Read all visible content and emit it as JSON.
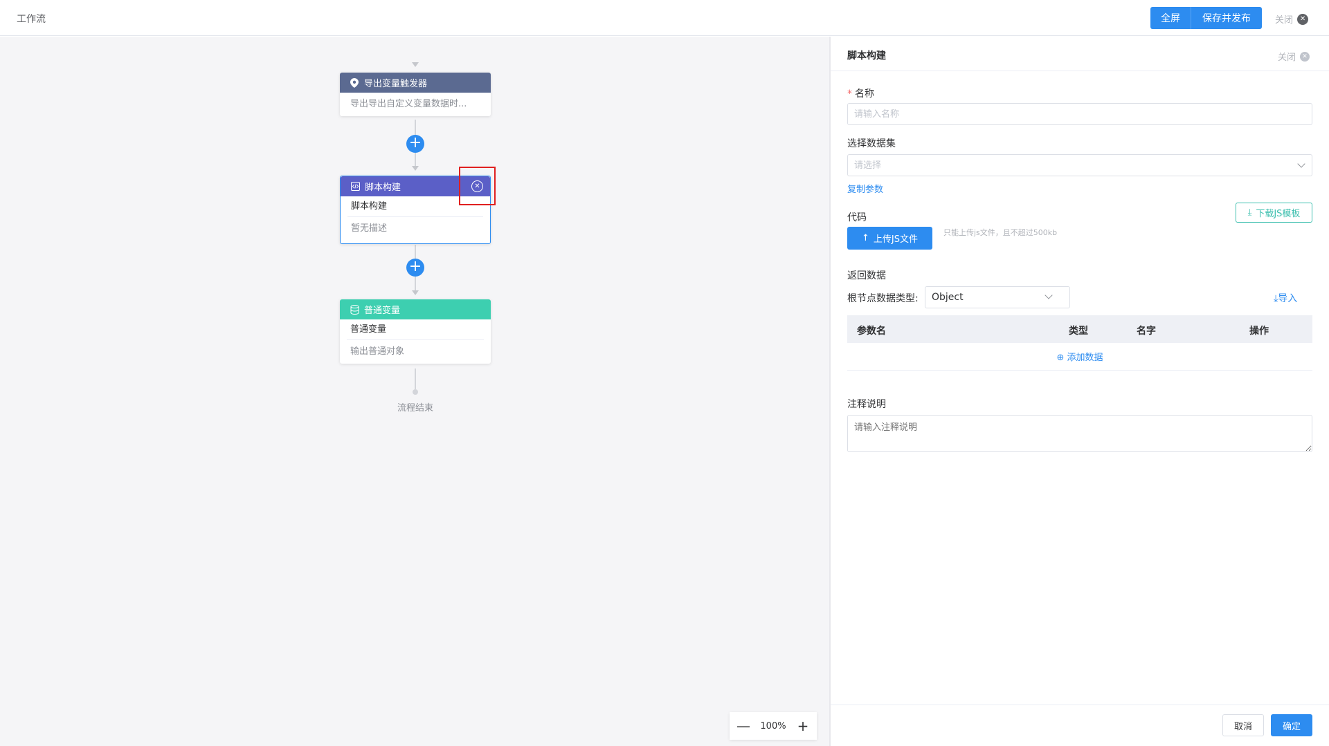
{
  "topbar": {
    "title": "工作流",
    "fullscreen_label": "全屏",
    "save_publish_label": "保存并发布",
    "close_label": "关闭"
  },
  "flow": {
    "nodes": [
      {
        "title": "导出变量触发器",
        "icon": "location-pin-icon",
        "header_color": "#5b6a91",
        "desc": "导出导出自定义变量数据时..."
      },
      {
        "title": "脚本构建",
        "icon": "code-icon",
        "header_color": "#5b5fc7",
        "name": "脚本构建",
        "desc": "暂无描述"
      },
      {
        "title": "普通变量",
        "icon": "database-icon",
        "header_color": "#3dcfb0",
        "name": "普通变量",
        "desc": "输出普通对象"
      }
    ],
    "end_label": "流程结束",
    "zoom_level": "100%",
    "highlight_color": "#e02020"
  },
  "panel": {
    "title": "脚本构建",
    "close_label": "关闭",
    "name_label": "名称",
    "name_placeholder": "请输入名称",
    "dataset_label": "选择数据集",
    "dataset_placeholder": "请选择",
    "copy_params_link": "复制参数",
    "code_label": "代码",
    "download_template_label": "下载JS模板",
    "upload_label": "上传JS文件",
    "upload_hint": "只能上传js文件，且不超过500kb",
    "return_data_label": "返回数据",
    "root_type_label": "根节点数据类型:",
    "root_type_value": "Object",
    "import_label": "导入",
    "table_headers": [
      "参数名",
      "类型",
      "名字",
      "操作"
    ],
    "add_data_label": "添加数据",
    "comment_label": "注释说明",
    "comment_placeholder": "请输入注释说明",
    "cancel_label": "取消",
    "confirm_label": "确定"
  },
  "colors": {
    "primary": "#2d8cf0",
    "success_outline": "#3cbfae"
  }
}
